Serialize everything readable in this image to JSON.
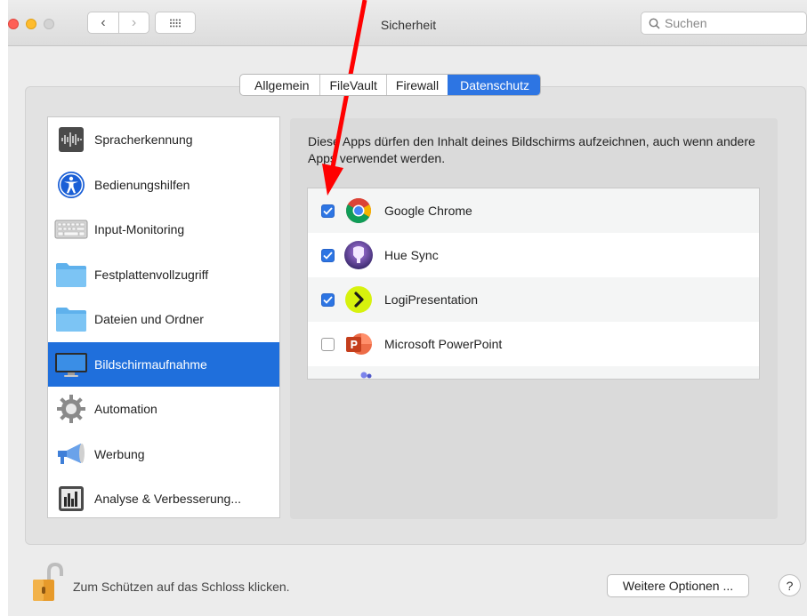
{
  "window": {
    "title": "Sicherheit",
    "search_placeholder": "Suchen",
    "nav_back": "‹",
    "nav_forward": "›"
  },
  "tabs": [
    {
      "label": "Allgemein",
      "active": false
    },
    {
      "label": "FileVault",
      "active": false
    },
    {
      "label": "Firewall",
      "active": false
    },
    {
      "label": "Datenschutz",
      "active": true
    }
  ],
  "sidebar": {
    "items": [
      {
        "label": "Spracherkennung",
        "icon": "waveform-icon"
      },
      {
        "label": "Bedienungshilfen",
        "icon": "accessibility-icon"
      },
      {
        "label": "Input-Monitoring",
        "icon": "keyboard-icon"
      },
      {
        "label": "Festplattenvollzugriff",
        "icon": "folder-icon"
      },
      {
        "label": "Dateien und Ordner",
        "icon": "folder-icon"
      },
      {
        "label": "Bildschirmaufnahme",
        "icon": "display-icon",
        "selected": true
      },
      {
        "label": "Automation",
        "icon": "gear-icon"
      },
      {
        "label": "Werbung",
        "icon": "megaphone-icon"
      },
      {
        "label": "Analyse & Verbesserung...",
        "icon": "bar-chart-icon"
      }
    ]
  },
  "main": {
    "description": "Diese Apps dürfen den Inhalt deines Bildschirms aufzeichnen, auch wenn andere Apps verwendet werden.",
    "apps": [
      {
        "name": "Google Chrome",
        "checked": true,
        "icon": "chrome-icon"
      },
      {
        "name": "Hue Sync",
        "checked": true,
        "icon": "hue-sync-icon"
      },
      {
        "name": "LogiPresentation",
        "checked": true,
        "icon": "logipresentation-icon"
      },
      {
        "name": "Microsoft PowerPoint",
        "checked": false,
        "icon": "powerpoint-icon"
      }
    ]
  },
  "footer": {
    "lock_text": "Zum Schützen auf das Schloss klicken.",
    "more_options": "Weitere Optionen ...",
    "help": "?"
  },
  "colors": {
    "accent": "#2d75e3",
    "selection": "#1f6fdc",
    "annotation_arrow": "#ff0000"
  }
}
